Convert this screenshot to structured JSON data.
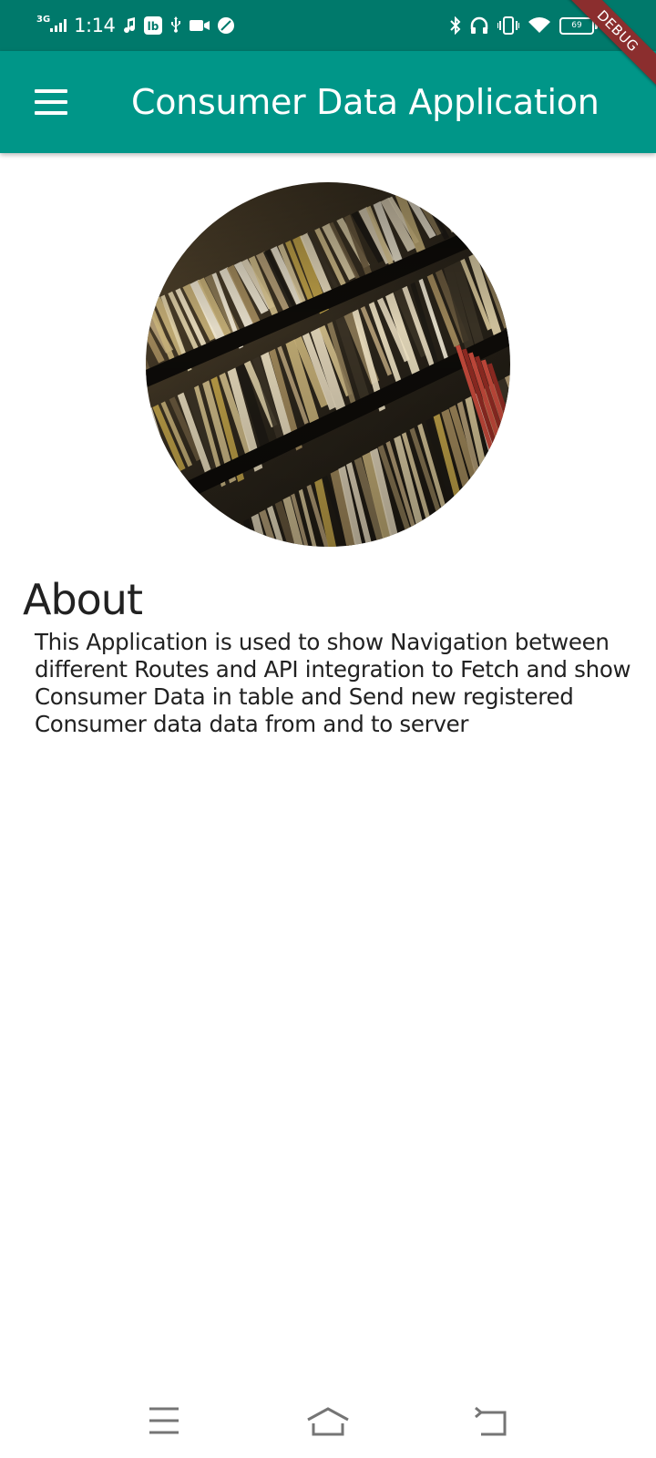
{
  "status_bar": {
    "network": "3G",
    "time": "1:14",
    "battery_level": "69",
    "left_icons": [
      "signal-icon",
      "music-note-icon",
      "app-notification-icon",
      "usb-icon",
      "video-icon",
      "leaf-icon"
    ],
    "right_icons": [
      "bluetooth-icon",
      "headphones-icon",
      "vibrate-icon",
      "wifi-icon",
      "battery-icon",
      "charging-icon"
    ]
  },
  "debug_banner": "DEBUG",
  "app_bar": {
    "title": "Consumer Data Application",
    "menu_icon": "hamburger-menu-icon"
  },
  "hero_image": {
    "description_icon": "vinyl-records-image"
  },
  "about": {
    "title": "About",
    "body": "This Application is used to show Navigation between different Routes and API integration to Fetch and show Consumer Data in table and Send new registered Consumer data data from and to server"
  },
  "nav_bar": {
    "items": [
      "recents-icon",
      "home-icon",
      "back-icon"
    ]
  },
  "colors": {
    "status_bar": "#00796b",
    "app_bar": "#009688",
    "debug_ribbon": "#8b2e2e",
    "text": "#212121"
  }
}
